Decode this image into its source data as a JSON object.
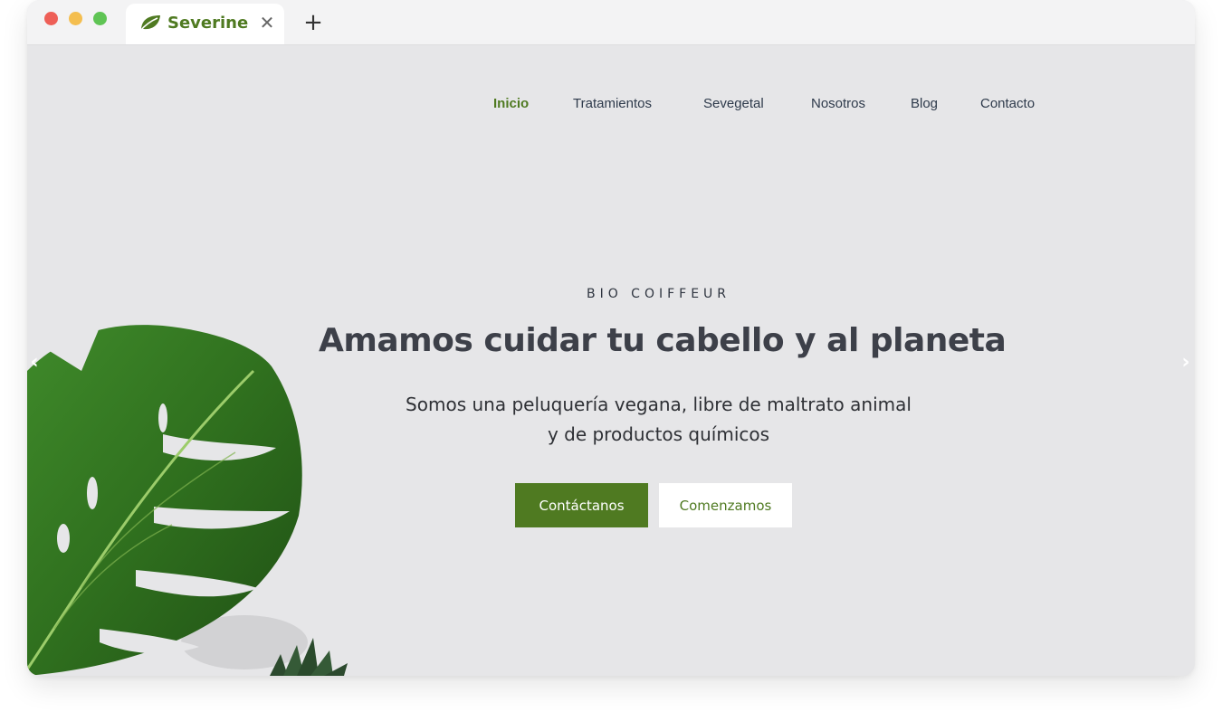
{
  "browser": {
    "tab_title": "Severine",
    "tab_icon": "leaf-icon",
    "close_icon": "close-icon",
    "new_tab_icon": "plus-icon",
    "close_glyph": "✕",
    "new_tab_glyph": "+"
  },
  "nav": {
    "items": [
      {
        "label": "Inicio",
        "active": true
      },
      {
        "label": "Tratamientos"
      },
      {
        "label": "Sevegetal"
      },
      {
        "label": "Nosotros"
      },
      {
        "label": "Blog"
      },
      {
        "label": "Contacto"
      }
    ]
  },
  "hero": {
    "eyebrow": "BIO COIFFEUR",
    "headline": "Amamos cuidar tu cabello y al planeta",
    "subtitle_line1": "Somos una peluquería vegana, libre de maltrato animal",
    "subtitle_line2": "y de productos químicos",
    "primary_button": "Contáctanos",
    "secondary_button": "Comenzamos"
  },
  "slider": {
    "prev_icon": "chevron-left-icon",
    "next_icon": "chevron-right-icon",
    "prev_glyph": "‹",
    "next_glyph": "›"
  },
  "colors": {
    "brand_green": "#4f7a21",
    "page_bg": "#e6e6e8",
    "text_dark": "#3d4049",
    "nav_text": "#2e3a4b"
  }
}
